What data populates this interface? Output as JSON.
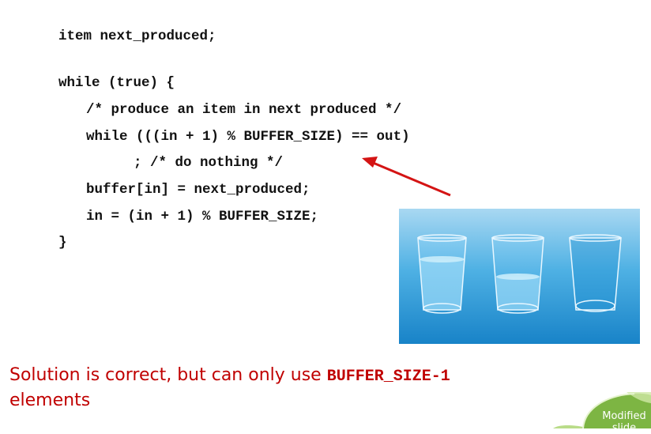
{
  "code": {
    "line1": "item next_produced;",
    "line2": "while (true) {",
    "line3": "/* produce an item in next produced */",
    "line4": "while (((in + 1) % BUFFER_SIZE) == out)",
    "line5": "; /* do nothing */",
    "line6": "buffer[in] = next_produced;",
    "line7": "in = (in + 1) % BUFFER_SIZE;",
    "line8": "}"
  },
  "solution": {
    "text_before": "Solution is correct, but can only use ",
    "code_term": "BUFFER_SIZE-1",
    "text_after": "elements"
  },
  "badge": {
    "line1": "Modified",
    "line2": "slide"
  },
  "colors": {
    "text_red": "#c00000",
    "arrow_red": "#d41414",
    "water_blue": "#2aa0dc",
    "badge_green": "#7db543"
  }
}
